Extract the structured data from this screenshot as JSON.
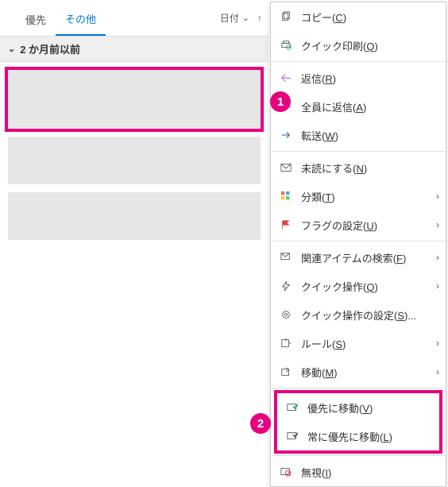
{
  "tabs": {
    "priority": "優先",
    "other": "その他"
  },
  "sort": {
    "label": "日付"
  },
  "group": {
    "label": "2 か月前以前"
  },
  "menu": {
    "copy": "コピー(C)",
    "quickPrint": "クイック印刷(Q)",
    "reply": "返信(R)",
    "replyAll": "全員に返信(A)",
    "forward": "転送(W)",
    "markUnread": "未読にする(N)",
    "categorize": "分類(T)",
    "flag": "フラグの設定(U)",
    "findRelated": "関連アイテムの検索(F)",
    "quickSteps": "クイック操作(Q)",
    "quickStepsSettings": "クイック操作の設定(S)...",
    "rules": "ルール(S)",
    "move": "移動(M)",
    "moveToPriority": "優先に移動(V)",
    "alwaysMoveToPriority": "常に優先に移動(L)",
    "ignore": "無視(I)"
  },
  "badges": {
    "one": "1",
    "two": "2"
  }
}
